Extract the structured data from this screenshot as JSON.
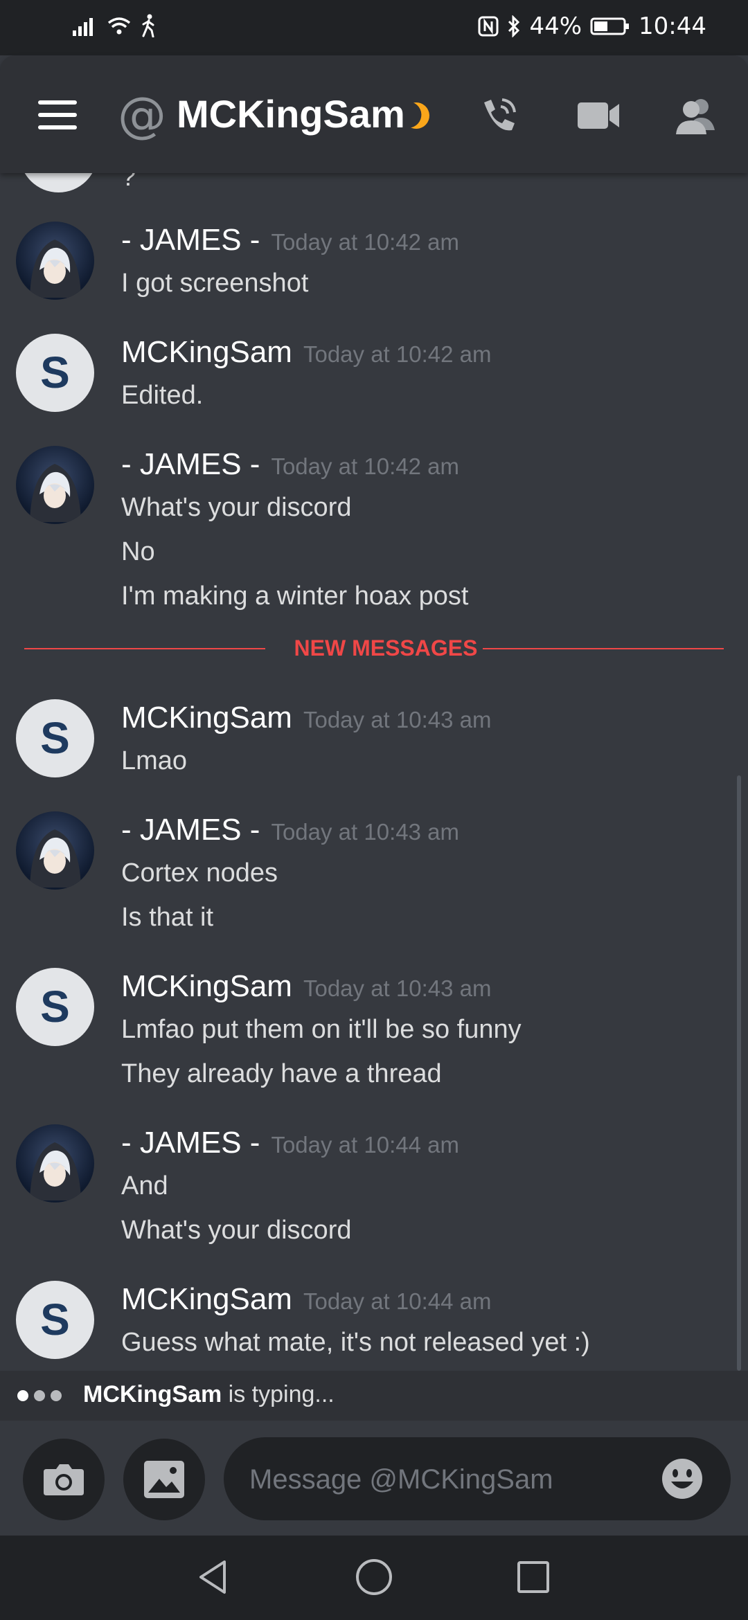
{
  "status_bar": {
    "battery": "44%",
    "time": "10:44"
  },
  "header": {
    "at_symbol": "@",
    "title": "MCKingSam"
  },
  "messages": [
    {
      "author": "- JAMES -",
      "avatar_kind": "james",
      "timestamp": "Today at 10:42 am",
      "lines": [
        "I got screenshot"
      ]
    },
    {
      "author": "MCKingSam",
      "avatar_kind": "sam",
      "avatar_letter": "S",
      "timestamp": "Today at 10:42 am",
      "lines": [
        "Edited."
      ]
    },
    {
      "author": "- JAMES -",
      "avatar_kind": "james",
      "timestamp": "Today at 10:42 am",
      "lines": [
        "What's your discord",
        "No",
        "I'm making a winter hoax post"
      ]
    },
    {
      "author": "MCKingSam",
      "avatar_kind": "sam",
      "avatar_letter": "S",
      "timestamp": "Today at 10:43 am",
      "lines": [
        "Lmao"
      ]
    },
    {
      "author": "- JAMES -",
      "avatar_kind": "james",
      "timestamp": "Today at 10:43 am",
      "lines": [
        "Cortex nodes",
        "Is that it"
      ]
    },
    {
      "author": "MCKingSam",
      "avatar_kind": "sam",
      "avatar_letter": "S",
      "timestamp": "Today at 10:43 am",
      "lines": [
        "Lmfao put them on it'll be so funny",
        "They already have a thread"
      ]
    },
    {
      "author": "- JAMES -",
      "avatar_kind": "james",
      "timestamp": "Today at 10:44 am",
      "lines": [
        "And",
        "What's your discord"
      ]
    },
    {
      "author": "MCKingSam",
      "avatar_kind": "sam",
      "avatar_letter": "S",
      "timestamp": "Today at 10:44 am",
      "lines": [
        "Guess what mate, it's not released yet :)"
      ]
    }
  ],
  "partial_top": {
    "line": "?"
  },
  "divider": {
    "label": "NEW MESSAGES"
  },
  "typing": {
    "user": "MCKingSam",
    "text": " is typing..."
  },
  "composer": {
    "placeholder": "Message @MCKingSam"
  },
  "colors": {
    "background": "#36393f",
    "header": "#2f3136",
    "accent_new_messages": "#f04747",
    "status_moon": "#faa61a"
  },
  "icons": [
    "menu-icon",
    "call-icon",
    "video-icon",
    "members-icon",
    "camera-icon",
    "image-icon",
    "emoji-icon",
    "back-nav-icon",
    "home-nav-icon",
    "recents-nav-icon"
  ]
}
